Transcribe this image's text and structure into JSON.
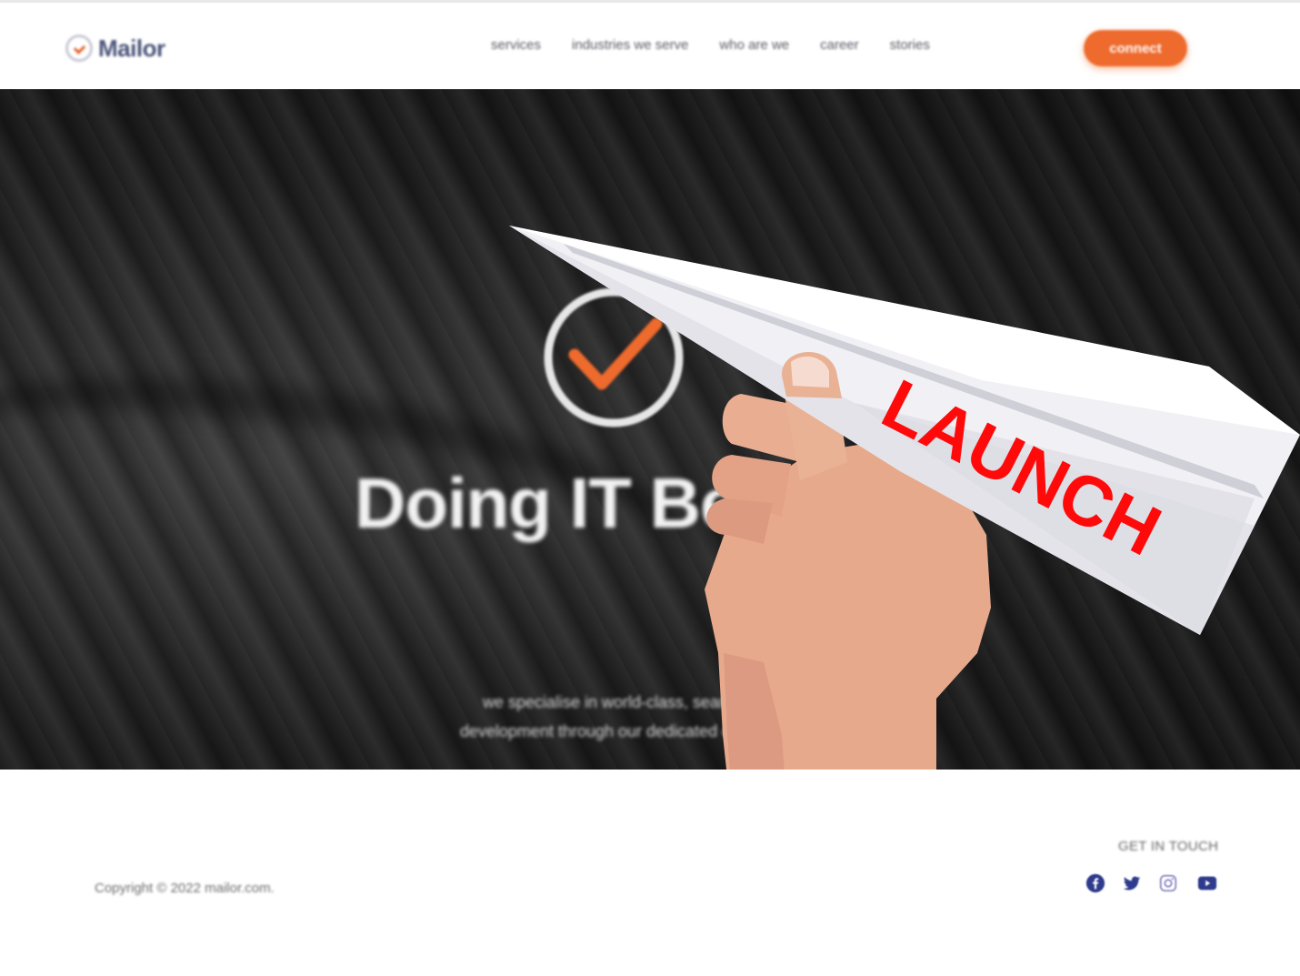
{
  "header": {
    "logo_text": "Mailor",
    "nav": [
      "services",
      "industries we serve",
      "who are we",
      "career",
      "stories"
    ],
    "cta_label": "connect"
  },
  "hero": {
    "title": "Doing IT Bet",
    "subtitle_line1": "we specialise in world-class, seamles",
    "subtitle_line2": "development through our dedicated on dem",
    "overlay_label": "LAUNCH"
  },
  "footer": {
    "copyright": "Copyright © 2022 mailor.com.",
    "get_in_touch": "GET IN TOUCH",
    "social": [
      "facebook-icon",
      "twitter-icon",
      "instagram-icon",
      "youtube-icon"
    ]
  },
  "colors": {
    "accent": "#ee6a2d",
    "nav_text": "#5a5a66",
    "hero_bg": "#1e1e1e",
    "social": "#2e3a8c",
    "launch_text": "#ff0a0a"
  }
}
